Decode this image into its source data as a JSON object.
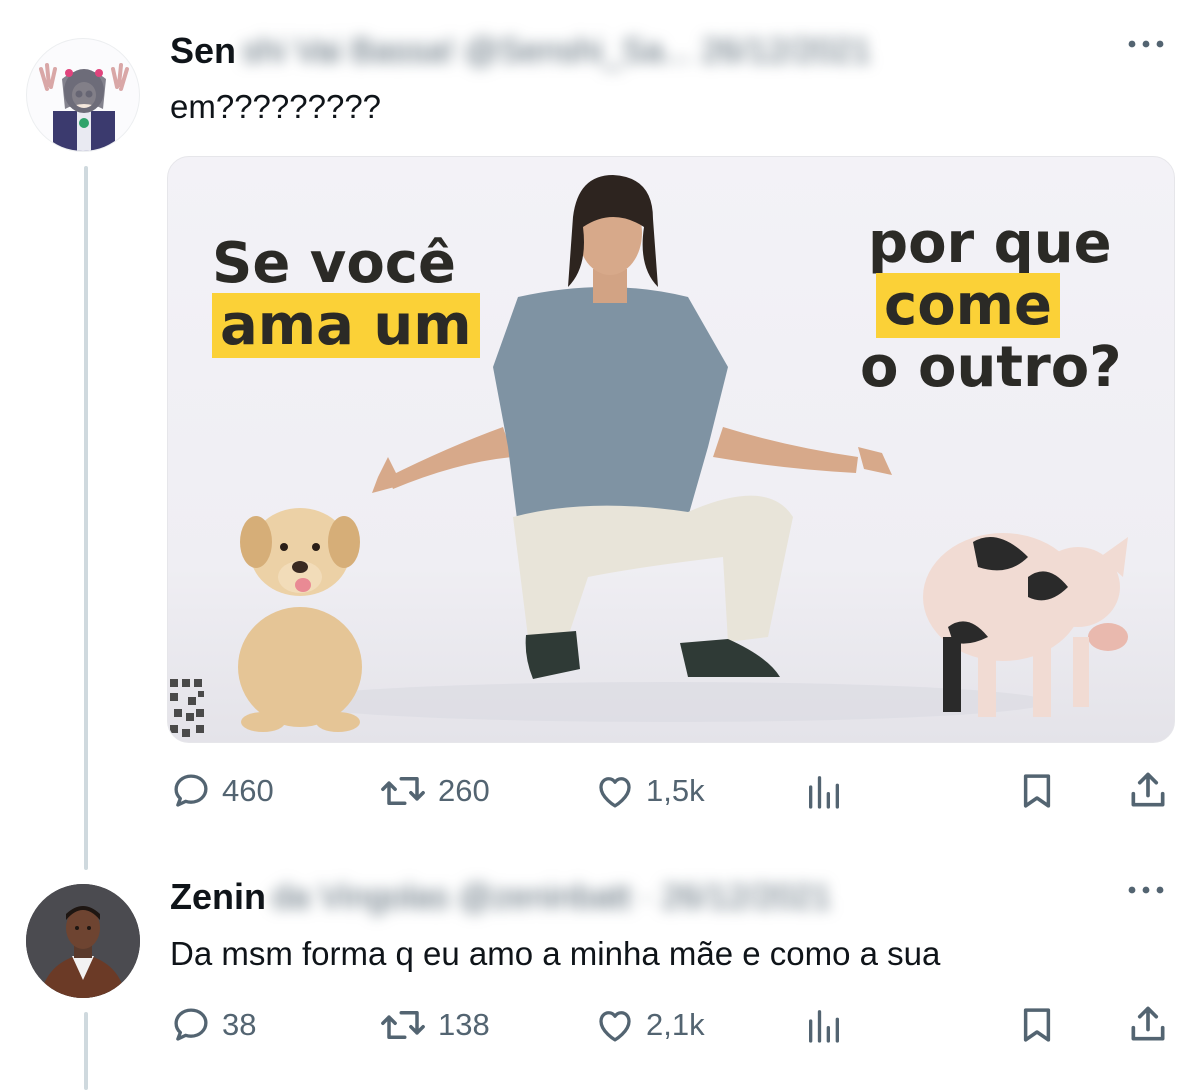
{
  "tweets": [
    {
      "display_name": "Sen",
      "handle_and_date": "shi Vai Bassa! @Senshi_Sa... 26/12/2021",
      "text": "em?????????",
      "media_text": {
        "left_line1": "Se você",
        "left_line2": "ama um",
        "right_line1": "por que",
        "right_line2": "come",
        "right_line3": "o outro?"
      },
      "actions": {
        "replies": "460",
        "reposts": "260",
        "likes": "1,5k"
      }
    },
    {
      "display_name": "Zenin",
      "handle_and_date": "da Vingolas @zeninbatt · 26/12/2021",
      "text": "Da msm forma q eu amo a minha mãe e como a sua",
      "actions": {
        "replies": "38",
        "reposts": "138",
        "likes": "2,1k"
      }
    }
  ],
  "icons": [
    "more-icon",
    "reply-icon",
    "repost-icon",
    "like-icon",
    "views-icon",
    "bookmark-icon",
    "share-icon"
  ],
  "colors": {
    "icon_gray": "#536471",
    "text": "#0f1419",
    "highlight_yellow": "#fbd137",
    "thread_line": "#cfd9de"
  }
}
